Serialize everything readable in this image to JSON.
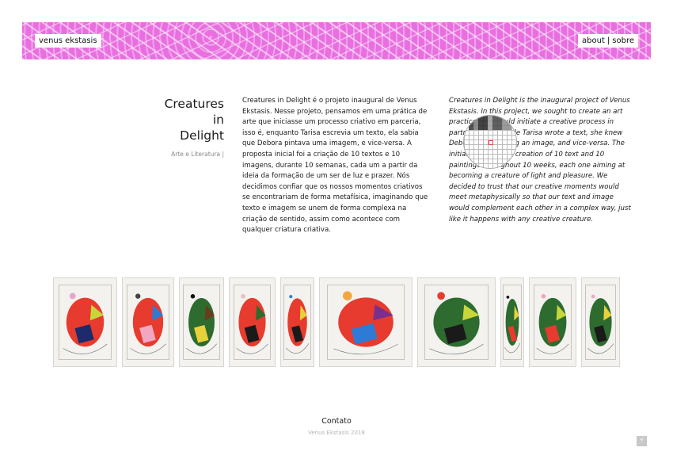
{
  "header": {
    "brand": "venus ekstasis",
    "nav": [
      {
        "label": "about"
      },
      {
        "label": "sobre"
      }
    ],
    "nav_separator": "|",
    "banner_color": "#e96fe0"
  },
  "project": {
    "title_lines": [
      "Creatures",
      "in",
      "Delight"
    ],
    "category": "Arte e Literatura |",
    "text_pt": "Creatures in Delight é o projeto inaugural de Venus Ekstasis. Nesse projeto, pensamos em uma prática de arte que iniciasse um processo criativo em parceria, isso é, enquanto Tarisa escrevia um texto, ela sabia que Debora pintava uma imagem, e vice-versa. A proposta inicial foi a criação de 10 textos e 10 imagens, durante 10 semanas, cada um a partir da ideia da formação de um ser de luz e prazer. Nós decidimos confiar que os nossos momentos criativos se encontrariam de forma metafísica, imaginando que texto e imagem se unem de forma complexa na criação de sentido, assim como acontece com qualquer criatura criativa.",
    "text_en": "Creatures in Delight is the inaugural project of Venus Ekstasis. In this project, we sought to create an art practice that would initiate a creative process in partnership, so while Tarisa wrote a text, she knew Debora was painting an image, and vice-versa. The initial idea was the creation of 10 text and 10 paintings throughout 10 weeks, each one aiming at becoming a creature of light and pleasure. We decided to trust that our creative moments would meet metaphysically so that our text and image would complement each other in a complex way, just like it happens with any creative creature."
  },
  "gallery": {
    "items": [
      {
        "name": "artwork-1",
        "palette": [
          "#e63b2e",
          "#1d2a6b",
          "#c9d63b",
          "#e7a8c8"
        ]
      },
      {
        "name": "artwork-2",
        "palette": [
          "#e63b2e",
          "#f2a7c0",
          "#2e7bd6",
          "#444444"
        ]
      },
      {
        "name": "artwork-3",
        "palette": [
          "#2d6b2f",
          "#e8d23a",
          "#6b3b1d",
          "#111111"
        ]
      },
      {
        "name": "artwork-4",
        "palette": [
          "#e63b2e",
          "#1a1a1a",
          "#2d6b2f",
          "#f0c0c0"
        ]
      },
      {
        "name": "artwork-5",
        "palette": [
          "#e63b2e",
          "#1a1a1a",
          "#e8d23a",
          "#2e7bd6"
        ]
      },
      {
        "name": "artwork-6",
        "palette": [
          "#e63b2e",
          "#2e7bd6",
          "#7a2f8c",
          "#f2a640"
        ]
      },
      {
        "name": "artwork-7",
        "palette": [
          "#2d6b2f",
          "#1a1a1a",
          "#c9d63b",
          "#e63b2e"
        ]
      },
      {
        "name": "artwork-8",
        "palette": [
          "#2d6b2f",
          "#e63b2e",
          "#e8d23a",
          "#1a1a1a"
        ]
      },
      {
        "name": "artwork-9",
        "palette": [
          "#2d6b2f",
          "#e63b2e",
          "#c9d63b",
          "#f2a7c0"
        ]
      },
      {
        "name": "artwork-10",
        "palette": [
          "#2d6b2f",
          "#1a1a1a",
          "#e8d23a",
          "#f2a7c0"
        ]
      }
    ]
  },
  "footer": {
    "contact": "Contato",
    "copyright": "Venus Ekstasis 2018",
    "corner_icon": "lightning-icon"
  }
}
